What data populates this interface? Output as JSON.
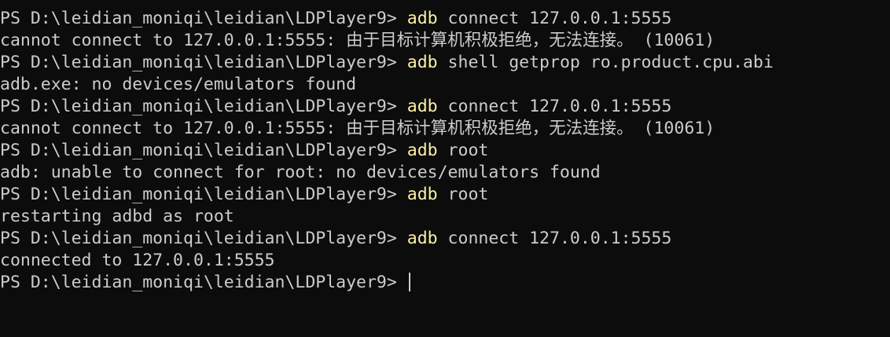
{
  "terminal": {
    "lines": [
      {
        "type": "cmd",
        "prompt": "PS D:\\leidian_moniqi\\leidian\\LDPlayer9> ",
        "cmd": "adb",
        "args": " connect 127.0.0.1:5555"
      },
      {
        "type": "out",
        "text": "cannot connect to 127.0.0.1:5555: 由于目标计算机积极拒绝，无法连接。 (10061)"
      },
      {
        "type": "cmd",
        "prompt": "PS D:\\leidian_moniqi\\leidian\\LDPlayer9> ",
        "cmd": "adb",
        "args": " shell getprop ro.product.cpu.abi"
      },
      {
        "type": "out",
        "text": "adb.exe: no devices/emulators found"
      },
      {
        "type": "cmd",
        "prompt": "PS D:\\leidian_moniqi\\leidian\\LDPlayer9> ",
        "cmd": "adb",
        "args": " connect 127.0.0.1:5555"
      },
      {
        "type": "out",
        "text": "cannot connect to 127.0.0.1:5555: 由于目标计算机积极拒绝，无法连接。 (10061)"
      },
      {
        "type": "cmd",
        "prompt": "PS D:\\leidian_moniqi\\leidian\\LDPlayer9> ",
        "cmd": "adb",
        "args": " root"
      },
      {
        "type": "out",
        "text": "adb: unable to connect for root: no devices/emulators found"
      },
      {
        "type": "cmd",
        "prompt": "PS D:\\leidian_moniqi\\leidian\\LDPlayer9> ",
        "cmd": "adb",
        "args": " root"
      },
      {
        "type": "out",
        "text": "restarting adbd as root"
      },
      {
        "type": "cmd",
        "prompt": "PS D:\\leidian_moniqi\\leidian\\LDPlayer9> ",
        "cmd": "adb",
        "args": " connect 127.0.0.1:5555"
      },
      {
        "type": "out",
        "text": "connected to 127.0.0.1:5555"
      }
    ],
    "current_prompt": "PS D:\\leidian_moniqi\\leidian\\LDPlayer9> ",
    "colors": {
      "background": "#0c0c0c",
      "foreground": "#cccccc",
      "command": "#f9f1a5"
    }
  }
}
